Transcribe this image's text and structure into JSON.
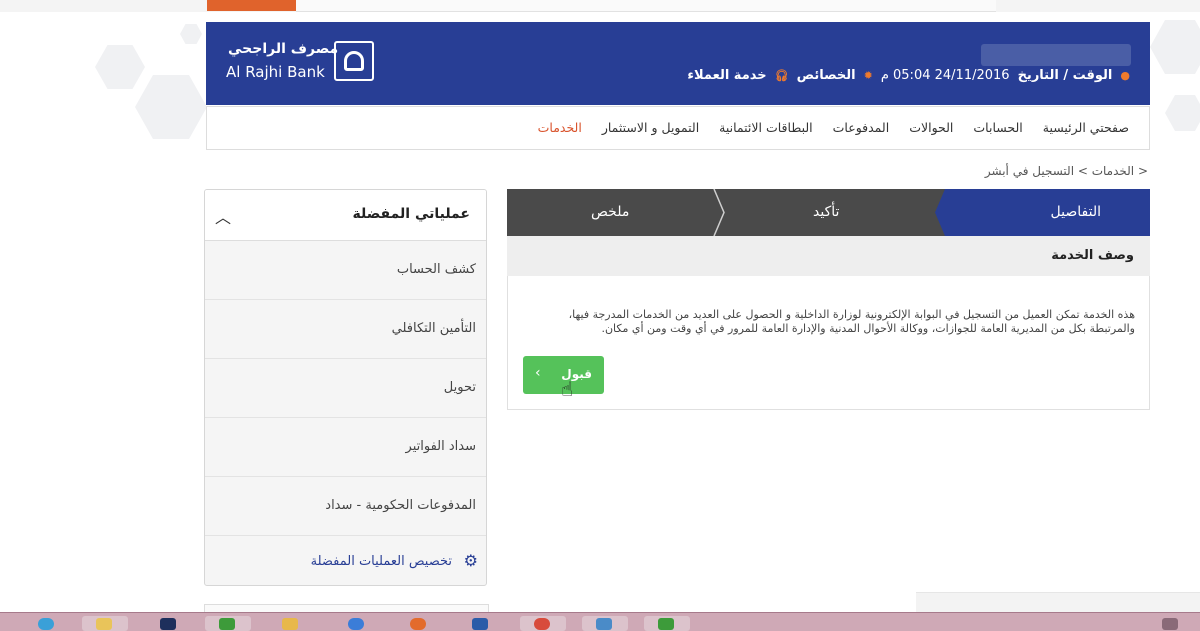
{
  "header": {
    "brand_ar": "مصرف الراجحي",
    "brand_en": "Al Rajhi Bank",
    "time_label": "الوقت / التاريخ",
    "datetime": "24/11/2016 05:04 م",
    "features": "الخصائص",
    "customer_service": "خدمة العملاء",
    "colors": {
      "primary": "#283e95",
      "accent": "#f07a2c"
    }
  },
  "nav": {
    "items": [
      {
        "label": "صفحتي الرئيسية"
      },
      {
        "label": "الحسابات"
      },
      {
        "label": "الحوالات"
      },
      {
        "label": "المدفوعات"
      },
      {
        "label": "البطاقات الائتمانية"
      },
      {
        "label": "التمويل و الاستثمار"
      },
      {
        "label": "الخدمات"
      }
    ]
  },
  "breadcrumb": "< الخدمات > التسجيل في أبشر",
  "sidebar": {
    "title": "عملياتي المفضلة",
    "items": [
      {
        "label": "كشف الحساب"
      },
      {
        "label": "التأمين التكافلي"
      },
      {
        "label": "تحويل"
      },
      {
        "label": "سداد الفواتير"
      },
      {
        "label": "المدفوعات الحكومية - سداد"
      }
    ],
    "customize": "تخصيص العمليات المفضلة"
  },
  "steps": {
    "details": "التفاصيل",
    "confirm": "تأكيد",
    "summary": "ملخص"
  },
  "panel": {
    "title": "وصف الخدمة",
    "description": "هذه الخدمة تمكن العميل من التسجيل في البوابة الإلكترونية لوزارة الداخلية و الحصول على العديد من الخدمات المدرجة فيها، والمرتبطة بكل من المديرية العامة للجوازات، ووكالة الأحوال المدنية والإدارة العامة للمرور في أي وقت ومن أي مكان.",
    "accept": "قبول"
  }
}
